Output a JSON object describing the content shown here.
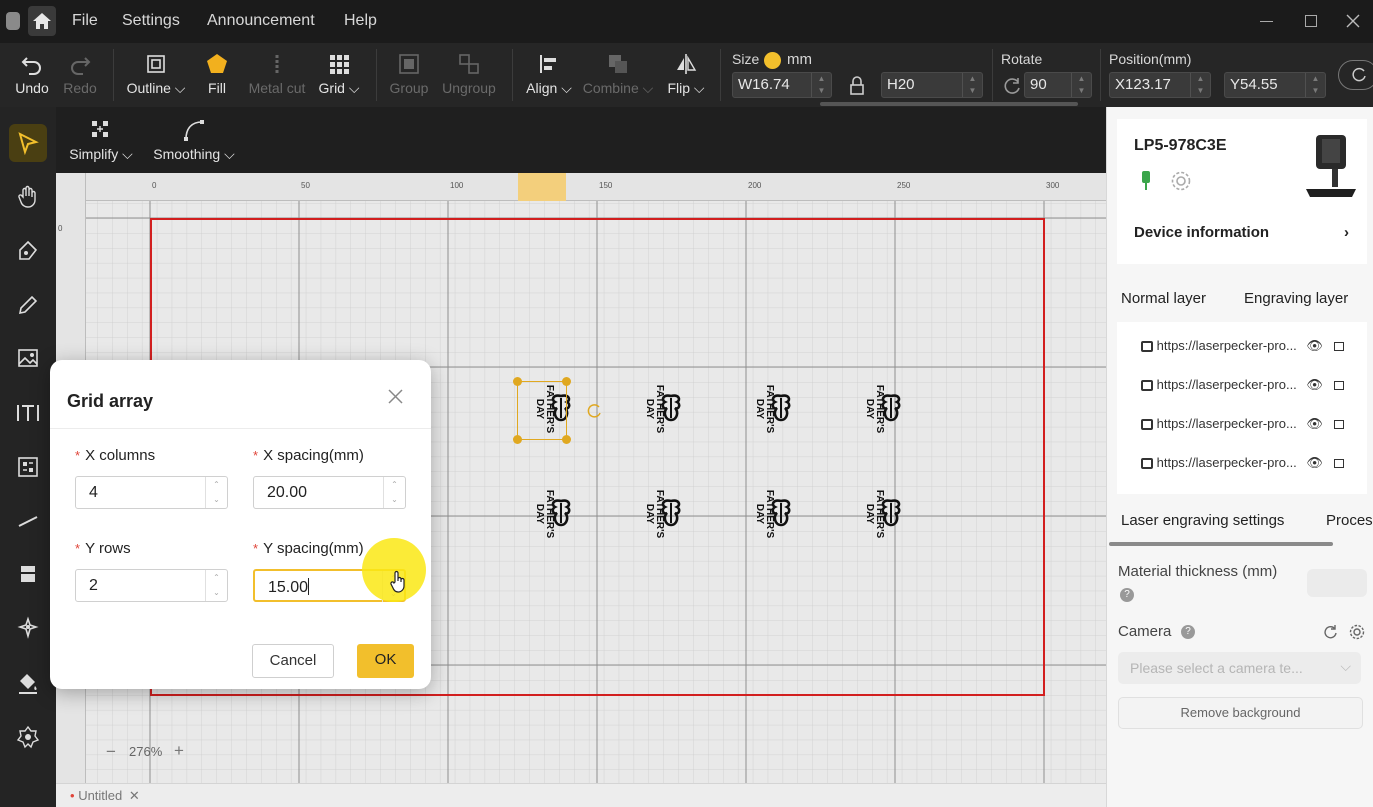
{
  "menu": {
    "items": [
      "File",
      "Settings",
      "Announcement",
      "Help"
    ]
  },
  "toolbar": {
    "undo": "Undo",
    "redo": "Redo",
    "outline": "Outline",
    "fill": "Fill",
    "metal_cut": "Metal cut",
    "grid": "Grid",
    "group": "Group",
    "ungroup": "Ungroup",
    "align": "Align",
    "combine": "Combine",
    "flip": "Flip",
    "size_label": "Size",
    "unit": "mm",
    "width_prefix": "W",
    "width": "16.74",
    "height_prefix": "H",
    "height": "20",
    "rotate_label": "Rotate",
    "rotate": "90",
    "position_label": "Position(mm)",
    "x_prefix": "X",
    "x": "123.17",
    "y_prefix": "Y",
    "y": "54.55"
  },
  "subtoolbar": {
    "simplify": "Simplify",
    "smoothing": "Smoothing"
  },
  "canvas": {
    "ruler_top": [
      "0",
      "50",
      "100",
      "150",
      "200",
      "250",
      "300"
    ],
    "ruler_left": [
      "0"
    ],
    "design_text_1": "FATHER'S",
    "design_text_2": "DAY",
    "zoom_minus": "−",
    "zoom": "276%",
    "zoom_plus": "+"
  },
  "tab": {
    "name": "Untitled"
  },
  "device": {
    "name": "LP5-978C3E",
    "info": "Device information"
  },
  "layers": {
    "tabs": [
      "Normal layer",
      "Engraving layer"
    ],
    "items": [
      "https://laserpecker-pro...",
      "https://laserpecker-pro...",
      "https://laserpecker-pro...",
      "https://laserpecker-pro..."
    ]
  },
  "settings": {
    "tabs": [
      "Laser engraving settings",
      "Proces"
    ],
    "material_thickness": "Material thickness (mm)",
    "camera": "Camera",
    "camera_placeholder": "Please select a camera te...",
    "remove_background": "Remove background"
  },
  "dialog": {
    "title": "Grid array",
    "x_columns_label": "X columns",
    "x_columns": "4",
    "x_spacing_label": "X spacing(mm)",
    "x_spacing": "20.00",
    "y_rows_label": "Y rows",
    "y_rows": "2",
    "y_spacing_label": "Y spacing(mm)",
    "y_spacing": "15.00",
    "cancel": "Cancel",
    "ok": "OK"
  },
  "colors": {
    "accent": "#f2bf2c",
    "workarea_border": "#d21f1f",
    "required": "#e0453a"
  }
}
